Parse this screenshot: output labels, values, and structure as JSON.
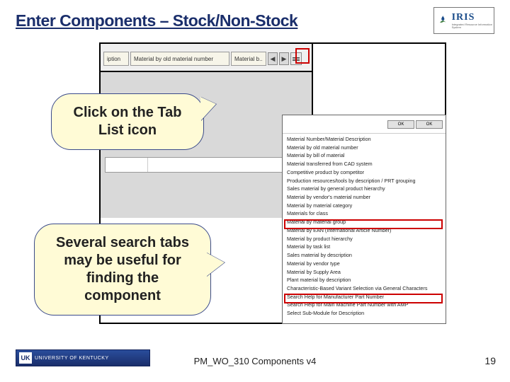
{
  "title": "Enter Components – Stock/Non-Stock",
  "logo": {
    "text": "IRIS",
    "subtitle": "Integrated Resource Information System"
  },
  "top_tabs": {
    "tab1": "iption",
    "tab2": "Material by old material number",
    "tab3": "Material b..",
    "arrow_left": "◀",
    "arrow_right": "▶"
  },
  "sap_field": {
    "label1": " ",
    "label2": " "
  },
  "ok_buttons": {
    "ok1": "OK",
    "ok2": "OK"
  },
  "dropdown_items": [
    "Material Number/Material Description",
    "Material by old material number",
    "Material by bill of material",
    "Material transferred from CAD system",
    "Competitive product by competitor",
    "Production resources/tools by description / PRT grouping",
    "Sales material by general product hierarchy",
    "Material by vendor's material number",
    "Material by material category",
    "Materials for class",
    "Material by material group",
    "Material by EAN (International Article Number)",
    "Material by product hierarchy",
    "Material by task list",
    "Sales material by description",
    "Material by vendor type",
    "Material by Supply Area",
    "Plant material by description",
    "Characteristic-Based Variant Selection via General Characters",
    "Search Help for Manufacturer Part Number",
    "Search Help for Main Machine Part Number with AMP",
    "Select Sub-Module for Description"
  ],
  "highlight_indices": {
    "first": 8,
    "second": 17
  },
  "callouts": {
    "c1": "Click on the Tab List icon",
    "c2": "Several search tabs may be useful for finding the component"
  },
  "uk_badge": {
    "mono": "UK",
    "text": "UNIVERSITY OF KENTUCKY"
  },
  "footer_center": "PM_WO_310 Components v4",
  "footer_page": "19"
}
